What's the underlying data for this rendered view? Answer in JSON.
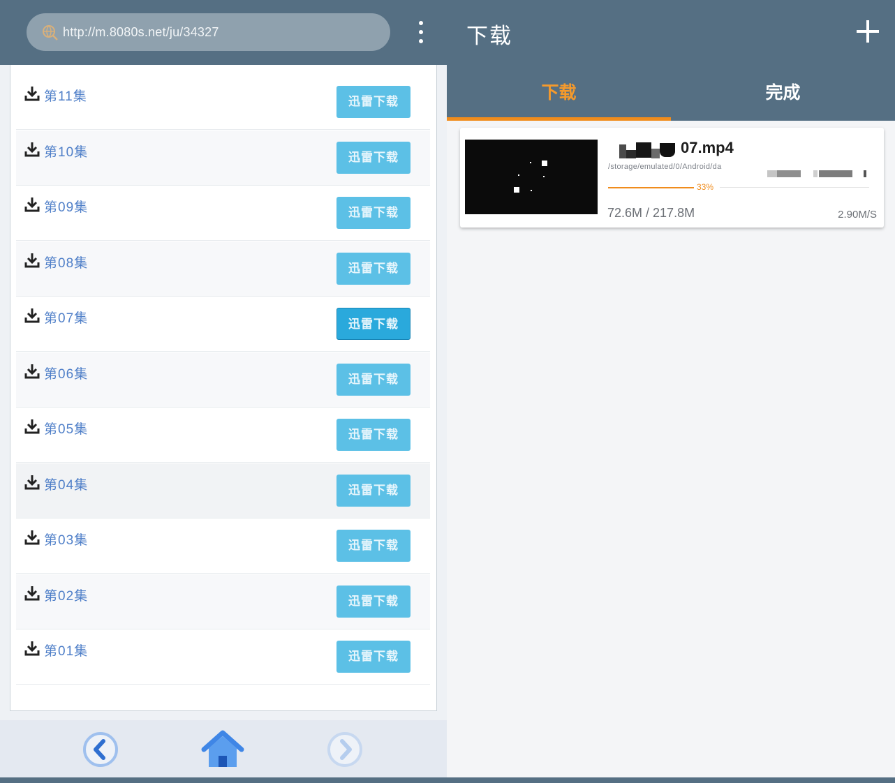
{
  "browser": {
    "url": "http://m.8080s.net/ju/34327"
  },
  "episodes": [
    {
      "label": "第11集",
      "button": "迅雷下载"
    },
    {
      "label": "第10集",
      "button": "迅雷下载"
    },
    {
      "label": "第09集",
      "button": "迅雷下载"
    },
    {
      "label": "第08集",
      "button": "迅雷下载"
    },
    {
      "label": "第07集",
      "button": "迅雷下载"
    },
    {
      "label": "第06集",
      "button": "迅雷下载"
    },
    {
      "label": "第05集",
      "button": "迅雷下载"
    },
    {
      "label": "第04集",
      "button": "迅雷下载"
    },
    {
      "label": "第03集",
      "button": "迅雷下载"
    },
    {
      "label": "第02集",
      "button": "迅雷下载"
    },
    {
      "label": "第01集",
      "button": "迅雷下载"
    }
  ],
  "downloads": {
    "title": "下载",
    "tabs": [
      "下载",
      "完成"
    ],
    "active_tab": 0,
    "item": {
      "name_suffix": "07.mp4",
      "path": "/storage/emulated/0/Android/da",
      "progress_percent": 33,
      "progress_label": "33%",
      "size": "72.6M / 217.8M",
      "speed": "2.90M/S"
    }
  },
  "colors": {
    "header": "#556f83",
    "accent": "#f08c1c",
    "button": "#5cc0e6",
    "link": "#4f7fc8"
  }
}
